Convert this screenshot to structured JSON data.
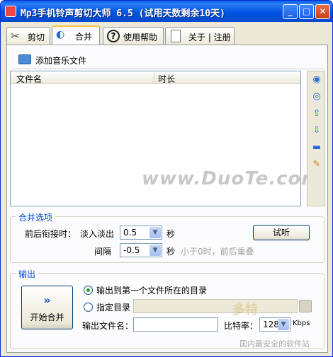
{
  "window": {
    "title": "Mp3手机铃声剪切大师 6.5 (试用天数剩余10天)"
  },
  "tabs": [
    {
      "label": "剪切",
      "icon": "scissors-icon"
    },
    {
      "label": "合并",
      "icon": "merge-icon"
    },
    {
      "label": "使用帮助",
      "icon": "help-icon"
    },
    {
      "label": "关于 | 注册",
      "icon": "document-icon"
    }
  ],
  "toolbar": {
    "add_label": "添加音乐文件"
  },
  "file_list": {
    "col_name": "文件名",
    "col_duration": "时长"
  },
  "watermark": "www.DuoTe.com",
  "merge_options": {
    "legend": "合并选项",
    "join_label": "前后衔接时：",
    "fade_label": "淡入淡出",
    "fade_value": "0.5",
    "fade_unit": "秒",
    "gap_label": "间隔",
    "gap_value": "-0.5",
    "gap_unit": "秒",
    "hint": "小于0时，前后重叠",
    "preview_label": "试听"
  },
  "output": {
    "legend": "输出",
    "start_label": "开始合并",
    "radio_same_dir": "输出到第一个文件所在的目录",
    "radio_custom_dir": "指定目录",
    "custom_dir_value": "",
    "filename_label": "输出文件名：",
    "filename_value": "",
    "bitrate_label": "比特率：",
    "bitrate_value": "128",
    "bitrate_unit": "Kbps"
  },
  "branding": {
    "logo_text": "多特",
    "slogan": "国内最安全的软件站"
  }
}
